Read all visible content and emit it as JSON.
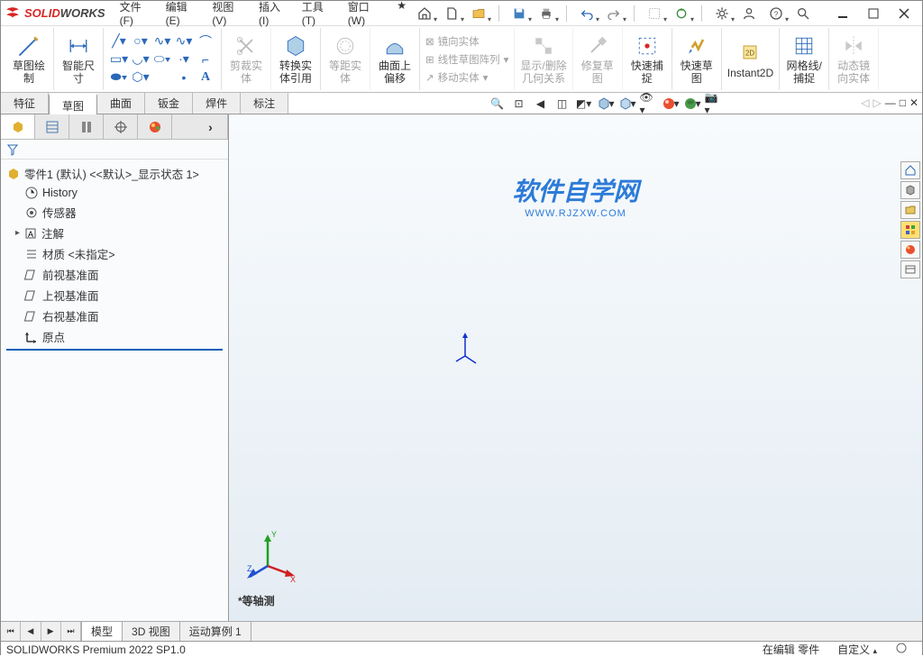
{
  "logo": {
    "brand1": "S",
    "brand2": "SOLID",
    "brand3": "WORKS"
  },
  "menu": {
    "file": "文件(F)",
    "edit": "编辑(E)",
    "view": "视图(V)",
    "insert": "插入(I)",
    "tools": "工具(T)",
    "window": "窗口(W)"
  },
  "ribbon": {
    "sketch_draw": "草图绘\n制",
    "smart_dim": "智能尺\n寸",
    "trim": "剪裁实\n体",
    "convert": "转换实\n体引用",
    "equidist": "等距实\n体",
    "curve_offset": "曲面上\n偏移",
    "mirror": "镜向实体",
    "linear_pattern": "线性草图阵列",
    "move": "移动实体",
    "display_del": "显示/删除\n几何关系",
    "repair": "修复草\n图",
    "quick_snap": "快速捕\n捉",
    "rapid_sketch": "快速草\n图",
    "instant2d": "Instant2D",
    "shaded_edge": "网格线/\n捕捉",
    "dynamic_mirror": "动态镜\n向实体"
  },
  "tabs": {
    "feature": "特征",
    "sketch": "草图",
    "surface": "曲面",
    "sheetmetal": "钣金",
    "weldment": "焊件",
    "annotate": "标注"
  },
  "tree": {
    "root": "零件1 (默认) <<默认>_显示状态 1>",
    "history": "History",
    "sensors": "传感器",
    "annotations": "注解",
    "material": "材质 <未指定>",
    "front_plane": "前视基准面",
    "top_plane": "上视基准面",
    "right_plane": "右视基准面",
    "origin": "原点"
  },
  "watermark": {
    "main": "软件自学网",
    "sub": "WWW.RJZXW.COM"
  },
  "orientation": "*等轴测",
  "bottom_tabs": {
    "model": "模型",
    "view3d": "3D 视图",
    "motion": "运动算例 1"
  },
  "status": {
    "version": "SOLIDWORKS Premium 2022 SP1.0",
    "editing": "在编辑 零件",
    "custom": "自定义"
  }
}
